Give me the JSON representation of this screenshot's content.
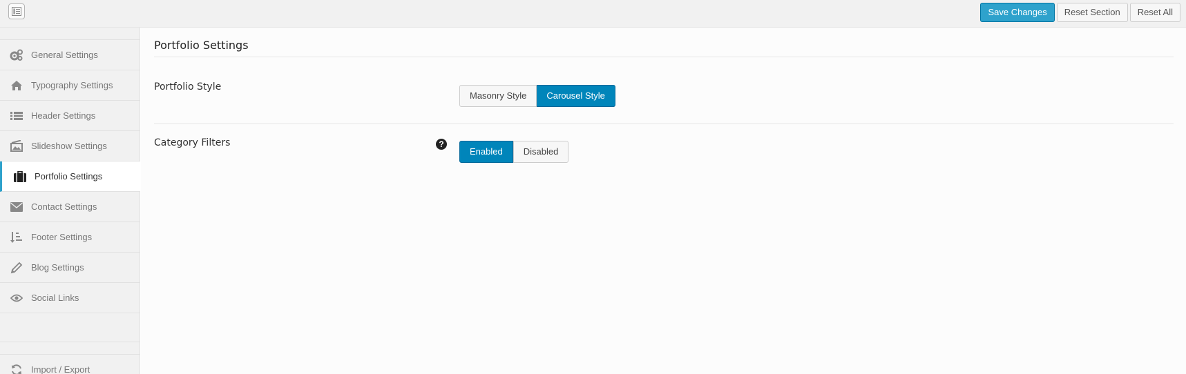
{
  "toolbar": {
    "save_label": "Save Changes",
    "reset_section_label": "Reset Section",
    "reset_all_label": "Reset All"
  },
  "sidebar": {
    "items": [
      {
        "label": "General Settings",
        "icon": "gears-icon"
      },
      {
        "label": "Typography Settings",
        "icon": "home-icon"
      },
      {
        "label": "Header Settings",
        "icon": "list-icon"
      },
      {
        "label": "Slideshow Settings",
        "icon": "slideshow-icon"
      },
      {
        "label": "Portfolio Settings",
        "icon": "briefcase-icon"
      },
      {
        "label": "Contact Settings",
        "icon": "envelope-icon"
      },
      {
        "label": "Footer Settings",
        "icon": "sort-list-icon"
      },
      {
        "label": "Blog Settings",
        "icon": "pencil-icon"
      },
      {
        "label": "Social Links",
        "icon": "eye-icon"
      }
    ],
    "active_index": 4,
    "import_export_label": "Import / Export"
  },
  "main": {
    "title": "Portfolio Settings",
    "portfolio_style": {
      "label": "Portfolio Style",
      "options": [
        "Masonry Style",
        "Carousel Style"
      ],
      "selected": "Carousel Style"
    },
    "category_filters": {
      "label": "Category Filters",
      "help": "?",
      "options": [
        "Enabled",
        "Disabled"
      ],
      "selected": "Enabled"
    }
  },
  "colors": {
    "primary": "#2ea2cc",
    "selected_option": "#0085ba",
    "sidebar_bg": "#f1f1f1"
  }
}
